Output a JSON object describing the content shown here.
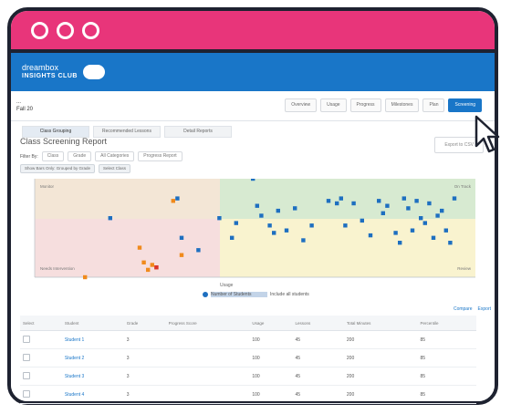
{
  "window": {
    "dots": 3,
    "titlebar_color": "#e8357a",
    "frame_color": "#1e2230"
  },
  "app": {
    "logo_text": "dreambox",
    "logo_sub": "INSIGHTS CLUB",
    "brand_color": "#1976c8"
  },
  "subheader": {
    "breadcrumb": "...",
    "title": "Fall 20"
  },
  "menu_buttons": [
    {
      "label": "Overview",
      "active": false
    },
    {
      "label": "Usage",
      "active": false
    },
    {
      "label": "Progress",
      "active": false
    },
    {
      "label": "Milestones",
      "active": false
    },
    {
      "label": "Plan",
      "active": false
    },
    {
      "label": "Screening",
      "active": true
    }
  ],
  "tabs": [
    {
      "label": "Class Grouping",
      "active": true
    },
    {
      "label": "Recommended Lessons",
      "active": false
    },
    {
      "label": "Detail Reports",
      "active": false
    }
  ],
  "report": {
    "title": "Class Screening Report",
    "export_label": "Export to CSV"
  },
  "filters": {
    "label": "Filter By:",
    "chips": [
      "Class",
      "Grade",
      "All Categories",
      "Progress Report"
    ]
  },
  "active_filters": [
    "Show Bars Only: Grouped by Grade",
    "Select Class"
  ],
  "chart_data": {
    "type": "scatter",
    "title": "",
    "xlabel": "Usage",
    "ylabel": "Progress",
    "quadrants": [
      {
        "label": "Needs Intervention",
        "color": "#f6dede"
      },
      {
        "label": "Monitor",
        "color": "#f3e6d6"
      },
      {
        "label": "On Track",
        "color": "#d7ead1"
      },
      {
        "label": "Review",
        "color": "#f9f3cf"
      }
    ],
    "series": [
      {
        "color": "#1e6fc0",
        "points": [
          [
            18,
            54
          ],
          [
            34,
            62
          ],
          [
            35,
            46
          ],
          [
            39,
            41
          ],
          [
            44,
            54
          ],
          [
            48,
            52
          ],
          [
            47,
            46
          ],
          [
            52,
            70
          ],
          [
            53,
            59
          ],
          [
            54,
            55
          ],
          [
            56,
            51
          ],
          [
            57,
            48
          ],
          [
            58,
            57
          ],
          [
            60,
            49
          ],
          [
            62,
            58
          ],
          [
            64,
            45
          ],
          [
            66,
            51
          ],
          [
            70,
            61
          ],
          [
            72,
            60
          ],
          [
            73,
            62
          ],
          [
            74,
            51
          ],
          [
            76,
            60
          ],
          [
            78,
            53
          ],
          [
            80,
            47
          ],
          [
            82,
            61
          ],
          [
            83,
            56
          ],
          [
            84,
            59
          ],
          [
            86,
            48
          ],
          [
            87,
            44
          ],
          [
            88,
            62
          ],
          [
            89,
            58
          ],
          [
            90,
            49
          ],
          [
            91,
            61
          ],
          [
            92,
            54
          ],
          [
            93,
            52
          ],
          [
            94,
            60
          ],
          [
            95,
            46
          ],
          [
            96,
            55
          ],
          [
            97,
            57
          ],
          [
            98,
            49
          ],
          [
            99,
            44
          ],
          [
            100,
            62
          ]
        ]
      },
      {
        "color": "#f08a1c",
        "points": [
          [
            12,
            30
          ],
          [
            25,
            42
          ],
          [
            26,
            36
          ],
          [
            27,
            33
          ],
          [
            28,
            35
          ],
          [
            29,
            34
          ],
          [
            33,
            61
          ],
          [
            35,
            39
          ]
        ]
      },
      {
        "color": "#d9342b",
        "points": [
          [
            29,
            34
          ]
        ]
      }
    ],
    "xlim": [
      0,
      105
    ],
    "ylim": [
      30,
      70
    ]
  },
  "legend": {
    "label": "Number of Students",
    "note": "Include all students"
  },
  "table_links": [
    "Compare",
    "Export"
  ],
  "table": {
    "columns": [
      "Select",
      "Student",
      "Grade",
      "Progress Score",
      "Usage",
      "Lessons",
      "Total Minutes",
      "Percentile"
    ],
    "rows": [
      {
        "name": "Student 1",
        "grade": "3",
        "score": "",
        "usage": "100",
        "lessons": "45",
        "minutes": "200",
        "pct": "85"
      },
      {
        "name": "Student 2",
        "grade": "3",
        "score": "",
        "usage": "100",
        "lessons": "45",
        "minutes": "200",
        "pct": "85"
      },
      {
        "name": "Student 3",
        "grade": "3",
        "score": "",
        "usage": "100",
        "lessons": "45",
        "minutes": "200",
        "pct": "85"
      },
      {
        "name": "Student 4",
        "grade": "3",
        "score": "",
        "usage": "100",
        "lessons": "45",
        "minutes": "200",
        "pct": "85"
      }
    ]
  }
}
